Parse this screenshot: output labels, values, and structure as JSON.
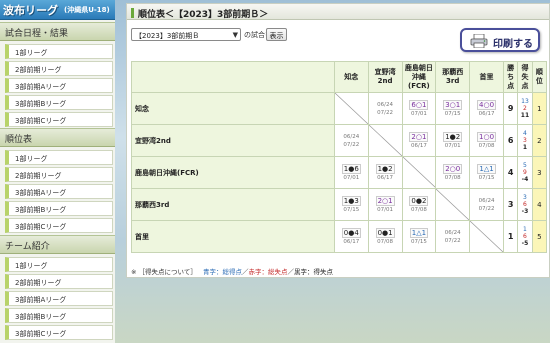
{
  "logo": {
    "title": "波布リーグ",
    "sub": "(沖縄県U-18)"
  },
  "sidebar": {
    "sections": [
      {
        "label": "試合日程・結果",
        "items": [
          "1部リーグ",
          "2部前期リーグ",
          "3部前期Aリーグ",
          "3部前期Bリーグ",
          "3部前期Cリーグ"
        ]
      },
      {
        "label": "順位表",
        "items": [
          "1部リーグ",
          "2部前期リーグ",
          "3部前期Aリーグ",
          "3部前期Bリーグ",
          "3部前期Cリーグ"
        ]
      },
      {
        "label": "チーム紹介",
        "items": [
          "1部リーグ",
          "2部前期リーグ",
          "3部前期Aリーグ",
          "3部前期Bリーグ",
          "3部前期Cリーグ"
        ]
      }
    ]
  },
  "main": {
    "title": "順位表＜【2023】3部前期Ｂ＞",
    "select_value": "【2023】3部前期Ｂ",
    "select_suffix": "の試合を",
    "show_label": "表示",
    "print_label": "印刷する",
    "headers": [
      "知念",
      "宜野湾\n2nd",
      "鹿島朝日\n沖縄\n(FCR)",
      "那覇西\n3rd",
      "首里",
      "勝ち\n点",
      "得失\n点",
      "順位"
    ],
    "rows": [
      {
        "team": "知念",
        "cells": [
          null,
          {
            "score": "",
            "d1": "06/24",
            "d2": "07/22",
            "style": "plain"
          },
          {
            "score": "6○1",
            "d2": "07/01",
            "style": "win"
          },
          {
            "score": "3○1",
            "d2": "07/15",
            "style": "win"
          },
          {
            "score": "4○0",
            "d2": "06/17",
            "style": "win"
          }
        ],
        "pts": "9",
        "gf": "13",
        "ga": "2",
        "gd": "11",
        "rank": "1"
      },
      {
        "team": "宜野湾2nd",
        "cells": [
          {
            "score": "",
            "d1": "06/24",
            "d2": "07/22",
            "style": "plain"
          },
          null,
          {
            "score": "2○1",
            "d2": "06/17",
            "style": "win"
          },
          {
            "score": "1●2",
            "d2": "07/01",
            "style": "plain"
          },
          {
            "score": "1○0",
            "d2": "07/08",
            "style": "win"
          }
        ],
        "pts": "6",
        "gf": "4",
        "ga": "3",
        "gd": "1",
        "rank": "2"
      },
      {
        "team": "鹿島朝日沖縄(FCR)",
        "cells": [
          {
            "score": "1●6",
            "d2": "07/01",
            "style": "plain"
          },
          {
            "score": "1●2",
            "d2": "06/17",
            "style": "plain"
          },
          null,
          {
            "score": "2○0",
            "d2": "07/08",
            "style": "win"
          },
          {
            "score": "1△1",
            "d2": "07/15",
            "style": "draw"
          }
        ],
        "pts": "4",
        "gf": "5",
        "ga": "9",
        "gd": "-4",
        "rank": "3"
      },
      {
        "team": "那覇西3rd",
        "cells": [
          {
            "score": "1●3",
            "d2": "07/15",
            "style": "plain"
          },
          {
            "score": "2○1",
            "d2": "07/01",
            "style": "win"
          },
          {
            "score": "0●2",
            "d2": "07/08",
            "style": "plain"
          },
          null,
          {
            "score": "",
            "d1": "06/24",
            "d2": "07/22",
            "style": "plain"
          }
        ],
        "pts": "3",
        "gf": "3",
        "ga": "6",
        "gd": "-3",
        "rank": "4"
      },
      {
        "team": "首里",
        "cells": [
          {
            "score": "0●4",
            "d2": "06/17",
            "style": "plain"
          },
          {
            "score": "0●1",
            "d2": "07/08",
            "style": "plain"
          },
          {
            "score": "1△1",
            "d2": "07/15",
            "style": "draw"
          },
          {
            "score": "",
            "d1": "06/24",
            "d2": "07/22",
            "style": "plain"
          },
          null
        ],
        "pts": "1",
        "gf": "1",
        "ga": "6",
        "gd": "-5",
        "rank": "5"
      }
    ],
    "legend": {
      "prefix": "※ ［得失点について］",
      "blue": "青字：総得点",
      "sep1": "／",
      "red": "赤字：総失点",
      "sep2": "／",
      "black": "黒字：得失点"
    }
  }
}
